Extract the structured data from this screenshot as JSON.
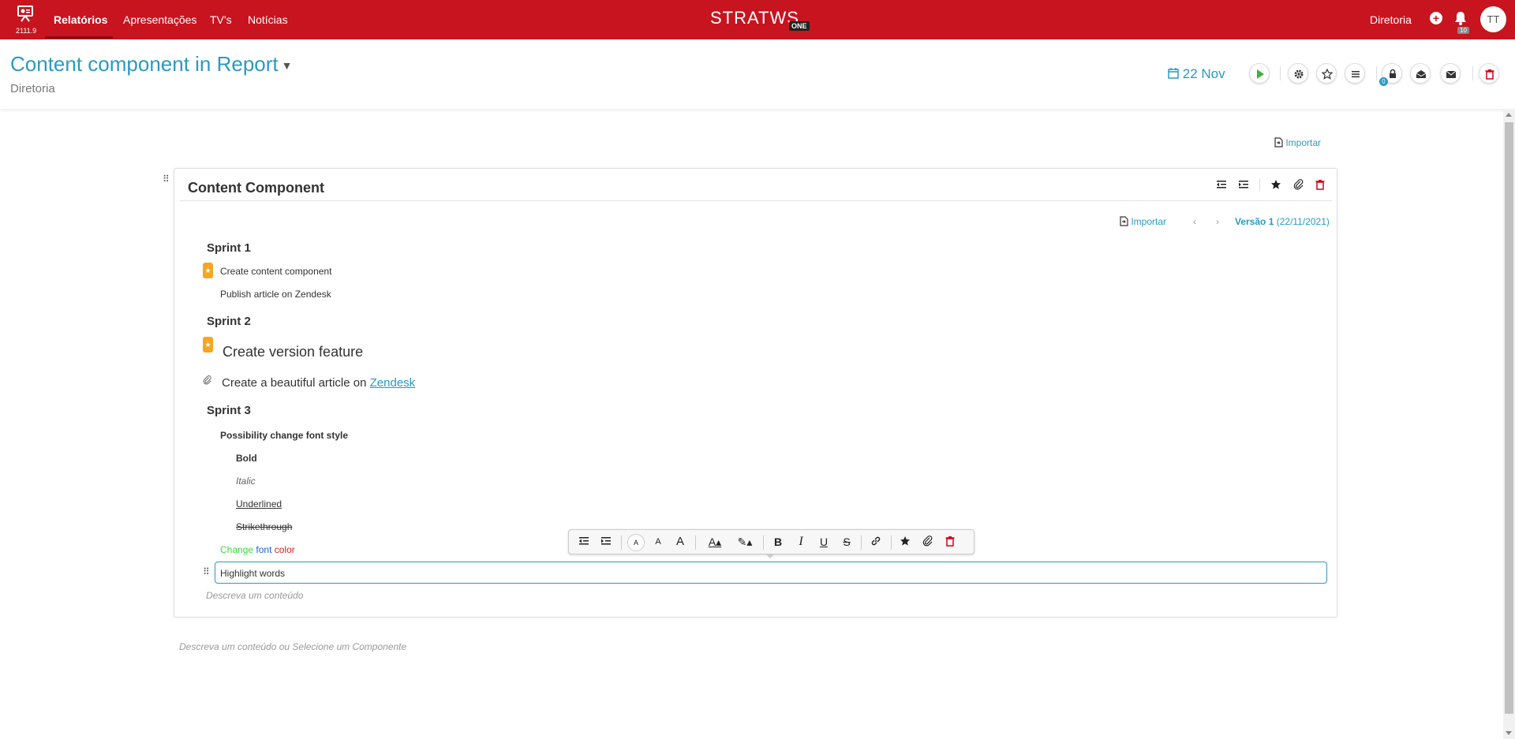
{
  "colors": {
    "brand": "#c8141f",
    "accent": "#2a9ac0",
    "star": "#f5a623",
    "green": "#3bd83b",
    "blue": "#1b5fe0",
    "red": "#e21c1c"
  },
  "topnav": {
    "version": "2111.9",
    "items": [
      "Relatórios",
      "Apresentações",
      "TV's",
      "Notícias"
    ],
    "brand": "STRATWS",
    "brand_badge": "ONE",
    "right_label": "Diretoria",
    "notifications": "10",
    "avatar": "TT"
  },
  "header": {
    "title": "Content component in Report",
    "subtitle": "Diretoria",
    "date": "22 Nov",
    "lock_count": "0"
  },
  "import_label": "Importar",
  "card": {
    "title": "Content Component",
    "import_label": "Importar",
    "version_label": "Versão 1",
    "version_date": "(22/11/2021)",
    "sprint1": "Sprint 1",
    "s1_item1": "Create content component",
    "s1_item2": "Publish article on Zendesk",
    "sprint2": "Sprint 2",
    "s2_item1": "Create version feature",
    "s2_item2_prefix": "Create a beautiful article on ",
    "s2_item2_link": "Zendesk",
    "sprint3": "Sprint 3",
    "s3_item1": "Possibility change font style",
    "bold": "Bold",
    "italic": "Italic",
    "underlined": "Underlined",
    "strike": "Strikethrough",
    "color_word1": "Change",
    "color_word2": "font",
    "color_word3": "color",
    "editor_value": "Highlight words",
    "desc_placeholder": "Descreva um conteúdo"
  },
  "bottom_placeholder": "Descreva um conteúdo ou Selecione um Componente"
}
